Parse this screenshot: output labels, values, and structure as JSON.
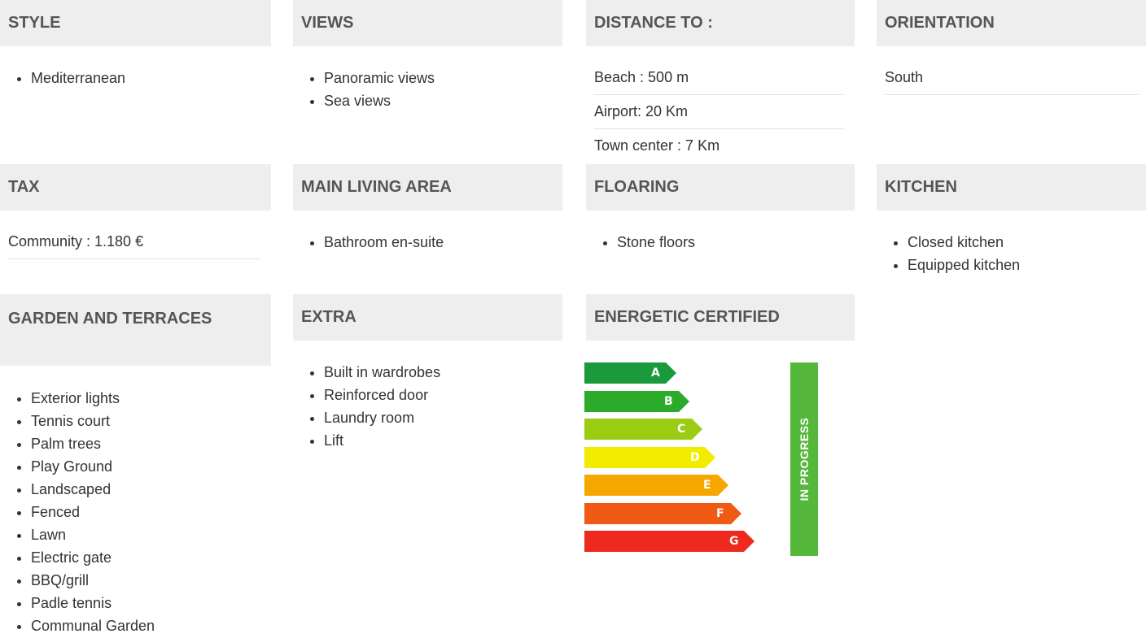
{
  "sections": {
    "style": {
      "title": "STYLE",
      "items": [
        "Mediterranean"
      ]
    },
    "views": {
      "title": "VIEWS",
      "items": [
        "Panoramic views",
        "Sea views"
      ]
    },
    "distance": {
      "title": "DISTANCE TO :",
      "rows": [
        "Beach : 500 m",
        "Airport: 20 Km",
        "Town center : 7 Km"
      ]
    },
    "orientation": {
      "title": "ORIENTATION",
      "rows": [
        "South"
      ]
    },
    "tax": {
      "title": "TAX",
      "rows": [
        "Community : 1.180 €"
      ]
    },
    "main_living": {
      "title": "MAIN LIVING AREA",
      "items": [
        "Bathroom en-suite"
      ]
    },
    "flooring": {
      "title": "FLOARING",
      "items": [
        "Stone floors"
      ]
    },
    "kitchen": {
      "title": "KITCHEN",
      "items": [
        "Closed kitchen",
        "Equipped kitchen"
      ]
    },
    "garden": {
      "title": "GARDEN AND TERRACES",
      "items": [
        "Exterior lights",
        "Tennis court",
        "Palm trees",
        "Play Ground",
        "Landscaped",
        "Fenced",
        "Lawn",
        "Electric gate",
        "BBQ/grill",
        "Padle tennis",
        "Communal Garden"
      ]
    },
    "extra": {
      "title": "EXTRA",
      "items": [
        "Built in wardrobes",
        "Reinforced door",
        "Laundry room",
        "Lift"
      ]
    },
    "energy": {
      "title": "ENERGETIC CERTIFIED",
      "status": "IN PROGRESS",
      "ratings": [
        {
          "label": "A",
          "color": "#1a9a3a"
        },
        {
          "label": "B",
          "color": "#2caa2c"
        },
        {
          "label": "C",
          "color": "#9acd12"
        },
        {
          "label": "D",
          "color": "#f2ec00"
        },
        {
          "label": "E",
          "color": "#f6a800"
        },
        {
          "label": "F",
          "color": "#f05a14"
        },
        {
          "label": "G",
          "color": "#ee2a1e"
        }
      ],
      "status_color": "#55b83a"
    }
  }
}
